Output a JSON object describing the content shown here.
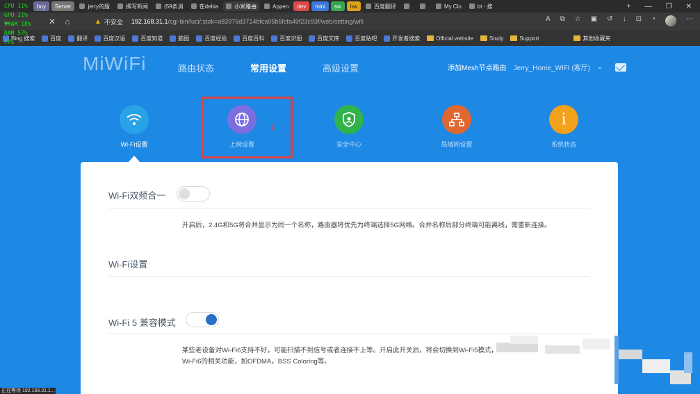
{
  "overlay": {
    "cpu": "CPU 11%",
    "gpu": "GPU 21%",
    "vram": "VRAM 18%",
    "ram": "RAM 57%",
    "fps": "FPS --"
  },
  "tabs": [
    {
      "label": "buy",
      "style": "pill"
    },
    {
      "label": "Server",
      "style": "pill server"
    },
    {
      "label": "jerry的服",
      "style": ""
    },
    {
      "label": "撰写新闻",
      "style": ""
    },
    {
      "label": "(59条消",
      "style": ""
    },
    {
      "label": "在debia",
      "style": ""
    },
    {
      "label": "小米路由",
      "style": "active"
    },
    {
      "label": "Appen",
      "style": ""
    },
    {
      "label": "dev",
      "style": "pill red"
    },
    {
      "label": "mini",
      "style": "pill blue"
    },
    {
      "label": "sw",
      "style": "pill green"
    },
    {
      "label": "hw",
      "style": "pill orange"
    },
    {
      "label": "百度翻译",
      "style": ""
    },
    {
      "label": "",
      "style": ""
    },
    {
      "label": "",
      "style": ""
    },
    {
      "label": "My Clo",
      "style": ""
    },
    {
      "label": "bt - 搜",
      "style": ""
    }
  ],
  "window_controls": {
    "new_tab": "+",
    "minimize": "—",
    "restore": "❐",
    "close": "✕"
  },
  "address": {
    "warning": "▲",
    "insecure_label": "不安全",
    "host": "192.168.31.1",
    "path": "/cgi-bin/luci/;stok=a83976d3714bfca05b5fcfa49f23c93f/web/setting/wifi"
  },
  "bookmarks": [
    {
      "label": "Bing 搜索",
      "type": "site"
    },
    {
      "label": "百度",
      "type": "site"
    },
    {
      "label": "翻译",
      "type": "site"
    },
    {
      "label": "百度汉语",
      "type": "site"
    },
    {
      "label": "百度知道",
      "type": "site"
    },
    {
      "label": "脑图",
      "type": "site"
    },
    {
      "label": "百度经验",
      "type": "site"
    },
    {
      "label": "百度百科",
      "type": "site"
    },
    {
      "label": "百度识图",
      "type": "site"
    },
    {
      "label": "百度文库",
      "type": "site"
    },
    {
      "label": "百度贴吧",
      "type": "site"
    },
    {
      "label": "开发者搜索",
      "type": "site"
    },
    {
      "label": "Official website",
      "type": "folder"
    },
    {
      "label": "Study",
      "type": "folder"
    },
    {
      "label": "Support",
      "type": "folder"
    },
    {
      "label": "其他收藏夹",
      "type": "folder"
    }
  ],
  "miwifi": {
    "logo": "MiWiFi",
    "nav": [
      {
        "label": "路由状态",
        "active": false
      },
      {
        "label": "常用设置",
        "active": true
      },
      {
        "label": "高级设置",
        "active": false
      }
    ],
    "add_mesh": "添加Mesh节点路由",
    "network_name": "Jerry_Home_WIFI (客厅)",
    "features": [
      {
        "label": "Wi-Fi设置",
        "color": "#29a3e8",
        "icon": "wifi-icon",
        "glyph": "◠"
      },
      {
        "label": "上网设置",
        "color": "#7b6fe0",
        "icon": "globe-icon",
        "glyph": "⊕"
      },
      {
        "label": "安全中心",
        "color": "#2fb34a",
        "icon": "shield-icon",
        "glyph": "⛨"
      },
      {
        "label": "局域网设置",
        "color": "#e0672f",
        "icon": "lan-icon",
        "glyph": "品"
      },
      {
        "label": "系统状态",
        "color": "#f1a11c",
        "icon": "info-icon",
        "glyph": "i"
      }
    ],
    "annotation": "1",
    "sections": {
      "dualband_title": "Wi-Fi双频合一",
      "dualband_desc": "开启后，2.4G和5G将合并显示为同一个名称，路由器将优先为终端选择5G网络。合并名称后部分终端可能离线，需重新连接。",
      "wifi_settings_title": "Wi-Fi设置",
      "wifi5_title": "Wi-Fi 5 兼容模式",
      "wifi5_desc": "某些老设备对Wi-Fi6支持不好，可能扫描不到信号或者连接不上等。开启此开关后，将会切换到Wi-Fi5模式，",
      "wifi5_desc2": "Wi-Fi6的相关功能，如OFDMA，BSS Coloring等。"
    },
    "toggles": {
      "dualband": false,
      "wifi5": true
    }
  },
  "statusbar": "正在等待 192.168.31.1..."
}
